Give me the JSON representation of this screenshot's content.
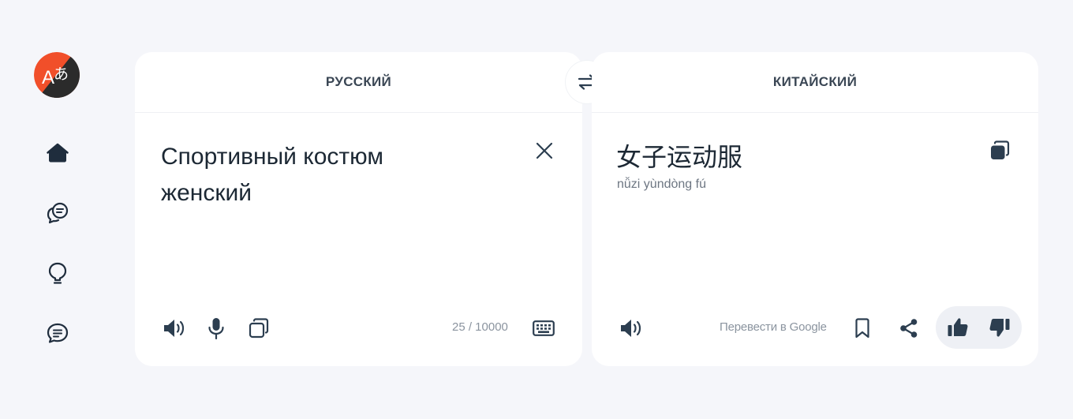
{
  "sidebar": {
    "logo_text": "A",
    "logo_glyph": "あ",
    "items": [
      {
        "name": "home",
        "icon": "home-icon"
      },
      {
        "name": "dialog",
        "icon": "dialog-icon"
      },
      {
        "name": "ideas",
        "icon": "lightbulb-icon"
      },
      {
        "name": "chat",
        "icon": "chat-icon"
      }
    ]
  },
  "source": {
    "language": "РУССКИЙ",
    "text": "Спортивный костюм\nженский",
    "counter": "25 / 10000"
  },
  "target": {
    "language": "КИТАЙСКИЙ",
    "text": "女子运动服",
    "transliteration": "nǚzi yùndòng fú",
    "google_link": "Перевести в Google"
  },
  "colors": {
    "background": "#f5f6fa",
    "panel": "#ffffff",
    "icon": "#2c3e50",
    "muted": "#8b949f",
    "logo_red": "#f14f2a",
    "logo_dark": "#2b2b2b",
    "vote_bg": "#eef0f5"
  }
}
